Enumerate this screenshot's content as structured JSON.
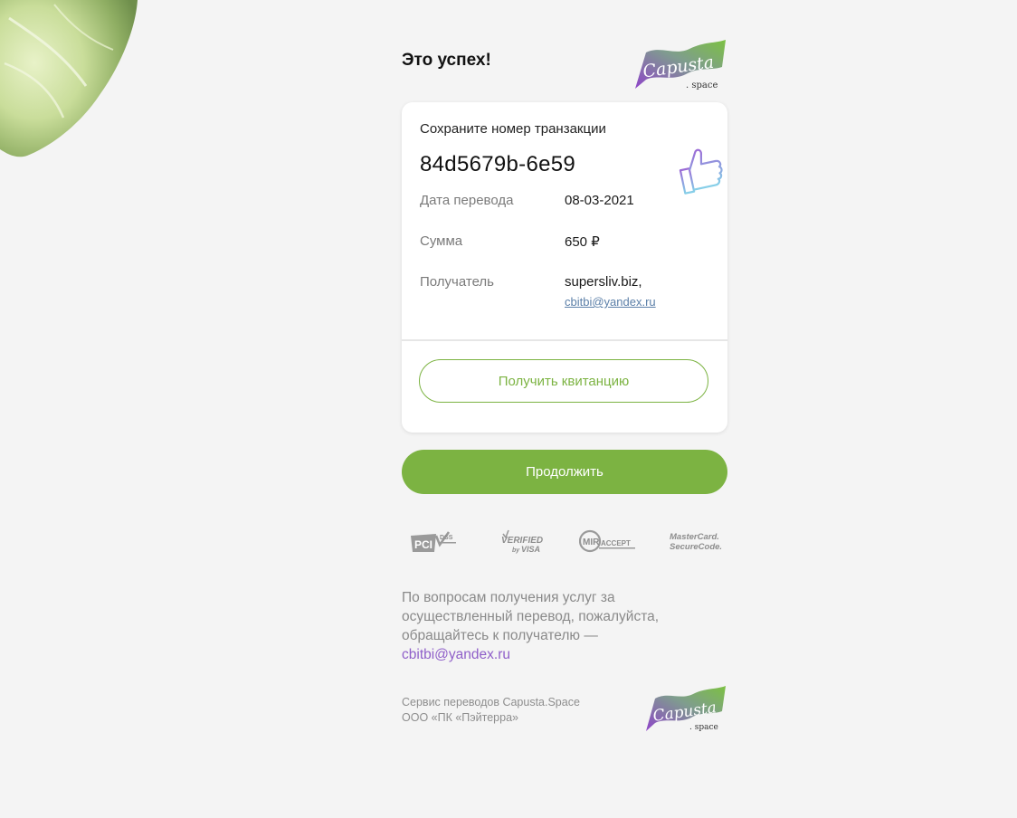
{
  "header": {
    "title": "Это успех!",
    "logo_text": "Capusta",
    "logo_suffix": ". space"
  },
  "transaction": {
    "label": "Сохраните номер транзакции",
    "id": "84d5679b-6e59",
    "rows": [
      {
        "label": "Дата перевода",
        "value": "08-03-2021"
      },
      {
        "label": "Сумма",
        "value": "650 ₽"
      },
      {
        "label": "Получатель",
        "value": "supersliv.biz,",
        "email": "cbitbi@yandex.ru"
      }
    ],
    "receipt_button": "Получить квитанцию"
  },
  "continue_button": "Продолжить",
  "security_badges": [
    {
      "name": "pci-dss",
      "text": "PCI DSS"
    },
    {
      "name": "verified-by-visa",
      "text": "VERIFIED by VISA"
    },
    {
      "name": "mir-accept",
      "text": "MIR ACCEPT"
    },
    {
      "name": "mastercard-securecode",
      "text": "MasterCard. SecureCode."
    }
  ],
  "support": {
    "text": "По вопросам получения услуг за осуществленный перевод, пожалуйста, обращайтесь к получателю —",
    "email": "cbitbi@yandex.ru"
  },
  "footer": {
    "line1": "Сервис переводов Capusta.Space",
    "line2": "ООО «ПК «Пэйтерра»"
  },
  "colors": {
    "accent_green": "#7cb342",
    "accent_purple": "#8f5fc9",
    "background": "#f4f4f4"
  }
}
